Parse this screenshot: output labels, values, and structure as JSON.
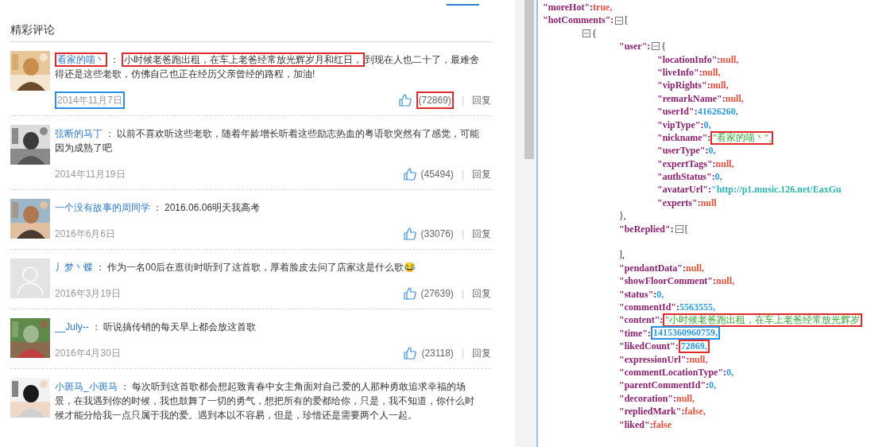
{
  "comments_panel": {
    "heading": "精彩评论",
    "comments": [
      {
        "avatar": {
          "kind": "picture"
        },
        "author": "看家的喵丶",
        "author_frame": {
          "color": "#e02a2a"
        },
        "separator": "：",
        "content": [
          {
            "text": "小时候老爸跑出租，在车上老爸经常放光辉岁月和红日，",
            "frame": {
              "color": "#e02a2a"
            }
          },
          {
            "text": "到现在人也二十了，最难舍得还是这些老歌，仿佛自己也正在经历父亲曾经的路程，加油!"
          }
        ],
        "date": "2014年11月7日",
        "date_frame": {
          "color": "#2b8fe3"
        },
        "likes": "(72869)",
        "likes_frame": {
          "color": "#e02a2a"
        },
        "divider": "|",
        "reply": "回复"
      },
      {
        "avatar": {
          "kind": "picture"
        },
        "author": "弦断的马丁",
        "separator": "：",
        "content": [
          {
            "text": "以前不喜欢听这些老歌，随着年龄增长听着这些励志热血的粤语歌突然有了感觉，可能因为成熟了吧"
          }
        ],
        "date": "2014年11月19日",
        "likes": "(45494)",
        "divider": "|",
        "reply": "回复"
      },
      {
        "avatar": {
          "kind": "picture"
        },
        "author": "一个没有故事的周同学",
        "separator": "：",
        "content": [
          {
            "text": "2016.06.06明天我高考"
          }
        ],
        "date": "2016年6月6日",
        "likes": "(33076)",
        "divider": "|",
        "reply": "回复"
      },
      {
        "avatar": {
          "kind": "default"
        },
        "author": "丿梦丶蝶",
        "separator": "：",
        "content": [
          {
            "text": "作为一名00后在逛街时听到了这首歌，厚着脸皮去问了店家这是什么歌😂"
          }
        ],
        "date": "2016年3月19日",
        "likes": "(27639)",
        "divider": "|",
        "reply": "回复"
      },
      {
        "avatar": {
          "kind": "picture"
        },
        "author": "__July--",
        "separator": "：",
        "content": [
          {
            "text": "听说搞传销的每天早上都会放这首歌"
          }
        ],
        "date": "2016年4月30日",
        "likes": "(23118)",
        "divider": "|",
        "reply": "回复"
      },
      {
        "avatar": {
          "kind": "picture"
        },
        "author": "小斑马_小斑马",
        "separator": "：",
        "content": [
          {
            "text": "每次听到这首歌都会想起致青春中女主角面对自己爱的人那种勇敢追求幸福的场景，在我遇到你的时候，我也鼓舞了一切的勇气，想把所有的爱都给你，只是，我不知道，你什么时候才能分给我一点只属于我的爱。遇到本以不容易，但是，珍惜还是需要两个人一起。"
          }
        ]
      }
    ]
  },
  "json_viewer": {
    "nodes": [
      {
        "key": "\"moreHot\":",
        "value": "true,",
        "kind": "literal"
      },
      {
        "key": "\"hotComments\":",
        "expanded": true,
        "open": "[",
        "children": [
          {
            "expanded": true,
            "open": "{",
            "children": [
              {
                "key": "\"user\":",
                "expanded": true,
                "open": "{",
                "close": "},",
                "children": [
                  {
                    "key": "\"locationInfo\":",
                    "value": "null,",
                    "kind": "literal"
                  },
                  {
                    "key": "\"liveInfo\":",
                    "value": "null,",
                    "kind": "literal"
                  },
                  {
                    "key": "\"vipRights\":",
                    "value": "null,",
                    "kind": "literal"
                  },
                  {
                    "key": "\"remarkName\":",
                    "value": "null,",
                    "kind": "literal"
                  },
                  {
                    "key": "\"userId\":",
                    "value": "41626260,",
                    "kind": "number"
                  },
                  {
                    "key": "\"vipType\":",
                    "value": "0,",
                    "kind": "number"
                  },
                  {
                    "key": "\"nickname\":",
                    "value": "\"看家的喵丶\",",
                    "kind": "string",
                    "frame": {
                      "color": "#e02a2a"
                    }
                  },
                  {
                    "key": "\"userType\":",
                    "value": "0,",
                    "kind": "number"
                  },
                  {
                    "key": "\"expertTags\":",
                    "value": "null,",
                    "kind": "literal"
                  },
                  {
                    "key": "\"authStatus\":",
                    "value": "0,",
                    "kind": "number"
                  },
                  {
                    "key": "\"avatarUrl\":",
                    "value": "\"http://p1.music.126.net/EaxGu",
                    "kind": "link"
                  },
                  {
                    "key": "\"experts\":",
                    "value": "null",
                    "kind": "literal"
                  }
                ]
              },
              {
                "key": "\"beReplied\":",
                "expanded": true,
                "open": "[",
                "close": "],"
              },
              {
                "key": "\"pendantData\":",
                "value": "null,",
                "kind": "literal"
              },
              {
                "key": "\"showFloorComment\":",
                "value": "null,",
                "kind": "literal"
              },
              {
                "key": "\"status\":",
                "value": "0,",
                "kind": "number"
              },
              {
                "key": "\"commentId\":",
                "value": "5563555,",
                "kind": "number"
              },
              {
                "key": "\"content\":",
                "value": "\"小时候老爸跑出租，在车上老爸经常放光辉岁",
                "kind": "string",
                "frame": {
                  "color": "#e02a2a"
                }
              },
              {
                "key": "\"time\":",
                "value": "1415360960759,",
                "kind": "number",
                "frame": {
                  "color": "#2b8fe3"
                }
              },
              {
                "key": "\"likedCount\":",
                "value": "72869,",
                "kind": "number",
                "frame": {
                  "color": "#e02a2a"
                }
              },
              {
                "key": "\"expressionUrl\":",
                "value": "null,",
                "kind": "literal"
              },
              {
                "key": "\"commentLocationType\":",
                "value": "0,",
                "kind": "number"
              },
              {
                "key": "\"parentCommentId\":",
                "value": "0,",
                "kind": "number"
              },
              {
                "key": "\"decoration\":",
                "value": "null,",
                "kind": "literal"
              },
              {
                "key": "\"repliedMark\":",
                "value": "false,",
                "kind": "literal"
              },
              {
                "key": "\"liked\":",
                "value": "false",
                "kind": "literal"
              }
            ]
          }
        ]
      }
    ]
  }
}
